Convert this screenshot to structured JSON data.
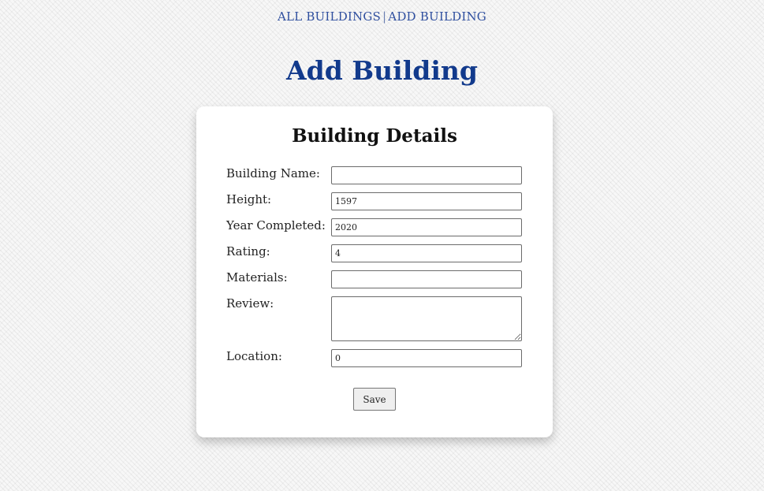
{
  "nav": {
    "all_buildings": "ALL BUILDINGS",
    "separator": "|",
    "add_building": "ADD BUILDING"
  },
  "page_title": "Add Building",
  "form": {
    "title": "Building Details",
    "fields": {
      "building_name": {
        "label": "Building Name:",
        "value": ""
      },
      "height": {
        "label": "Height:",
        "value": "1597"
      },
      "year_completed": {
        "label": "Year Completed:",
        "value": "2020"
      },
      "rating": {
        "label": "Rating:",
        "value": "4"
      },
      "materials": {
        "label": "Materials:",
        "value": ""
      },
      "review": {
        "label": "Review:",
        "value": ""
      },
      "location": {
        "label": "Location:",
        "value": "0"
      }
    },
    "save_label": "Save"
  },
  "colors": {
    "link": "#2f4f9f",
    "heading": "#123a8c",
    "card_background": "#ffffff"
  }
}
